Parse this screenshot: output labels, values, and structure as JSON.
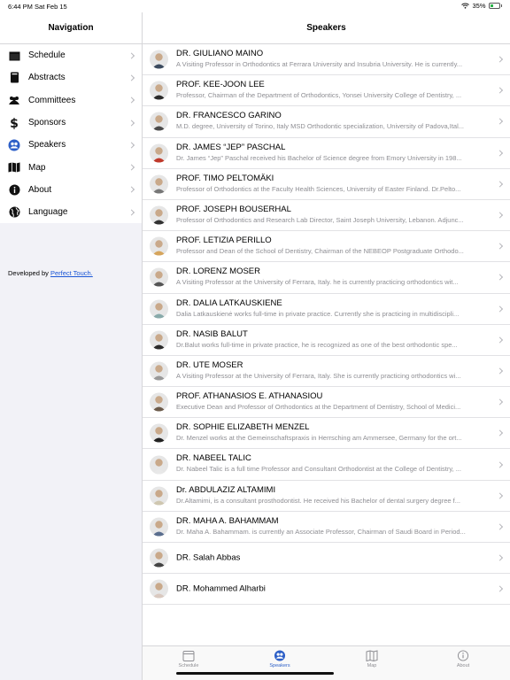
{
  "status": {
    "time": "6:44 PM  Sat Feb 15",
    "battery": "35%",
    "battery_level": 0.35
  },
  "sidebar": {
    "title": "Navigation",
    "items": [
      {
        "label": "Schedule",
        "icon": "calendar-icon"
      },
      {
        "label": "Abstracts",
        "icon": "book-icon"
      },
      {
        "label": "Committees",
        "icon": "group-icon"
      },
      {
        "label": "Sponsors",
        "icon": "dollar-icon"
      },
      {
        "label": "Speakers",
        "icon": "speakers-icon"
      },
      {
        "label": "Map",
        "icon": "map-icon"
      },
      {
        "label": "About",
        "icon": "info-icon"
      },
      {
        "label": "Language",
        "icon": "globe-icon"
      }
    ],
    "footer_prefix": "Developed by ",
    "footer_link": "Perfect Touch."
  },
  "main": {
    "title": "Speakers",
    "speakers": [
      {
        "name": "DR. GIULIANO MAINO",
        "desc": "A Visiting Professor in Orthodontics at Ferrara University and Insubria University. He is currently..."
      },
      {
        "name": "PROF. KEE-JOON LEE",
        "desc": "Professor, Chairman of the Department of Orthodontics, Yonsei University College of Dentistry, ..."
      },
      {
        "name": "DR. FRANCESCO GARINO",
        "desc": "M.D. degree, University of Torino, Italy MSD Orthodontic specialization, University of Padova,Ital..."
      },
      {
        "name": "DR. JAMES “JEP” PASCHAL",
        "desc": "Dr. James “Jep” Paschal received his Bachelor of Science degree from Emory University in 198..."
      },
      {
        "name": "PROF. TIMO PELTOMÄKI",
        "desc": "Professor of Orthodontics at the Faculty Health Sciences, University of Easter Finland. Dr.Pelto..."
      },
      {
        "name": "PROF. JOSEPH BOUSERHAL",
        "desc": "Professor of Orthodontics and Research Lab Director, Saint Joseph University, Lebanon. Adjunc..."
      },
      {
        "name": "PROF. LETIZIA PERILLO",
        "desc": "Professor and Dean of the School of Dentistry, Chairman of the NEBEOP Postgraduate Orthodo..."
      },
      {
        "name": "DR. LORENZ MOSER",
        "desc": "A Visiting Professor at the University of Ferrara, Italy. he is currently practicing orthodontics wit..."
      },
      {
        "name": "DR. DALIA LATKAUSKIENE",
        "desc": "Dalia Latkauskienė works full-time in private practice. Currently she is practicing in multidiscipli..."
      },
      {
        "name": "DR. NASIB BALUT",
        "desc": "Dr.Balut works full-time in private practice, he is recognized as one of the best orthodontic spe..."
      },
      {
        "name": "DR. UTE MOSER",
        "desc": "A Visiting Professor at the University of Ferrara, Italy. She is currently practicing orthodontics wi..."
      },
      {
        "name": "PROF. ATHANASIOS E. ATHANASIOU",
        "desc": "Executive Dean and Professor of Orthodontics at the Department of Dentistry, School of Medici..."
      },
      {
        "name": "DR. SOPHIE ELIZABETH MENZEL",
        "desc": "Dr. Menzel works at the Gemeinschaftspraxis in Herrsching am Ammersee, Germany for the ort..."
      },
      {
        "name": "DR. NABEEL TALIC",
        "desc": "Dr. Nabeel Talic is a full time Professor and Consultant Orthodontist at the College of Dentistry, ..."
      },
      {
        "name": "Dr. ABDULAZIZ ALTAMIMI",
        "desc": "Dr.Altamimi, is a consultant prosthodontist. He received his Bachelor of dental surgery degree f..."
      },
      {
        "name": "DR. MAHA A. BAHAMMAM",
        "desc": "Dr. Maha A. Bahammam. is currently an Associate Professor, Chairman of Saudi Board in Period..."
      },
      {
        "name": "DR. Salah Abbas",
        "desc": ""
      },
      {
        "name": "DR. Mohammed Alharbi",
        "desc": ""
      }
    ]
  },
  "tabs": [
    {
      "label": "Schedule",
      "icon": "calendar-tab-icon"
    },
    {
      "label": "Speakers",
      "icon": "speakers-tab-icon"
    },
    {
      "label": "Map",
      "icon": "map-tab-icon"
    },
    {
      "label": "About",
      "icon": "info-tab-icon"
    }
  ],
  "colors": {
    "accent": "#2d5fc7",
    "link": "#1a56d6",
    "battery": "#2bb34a"
  }
}
